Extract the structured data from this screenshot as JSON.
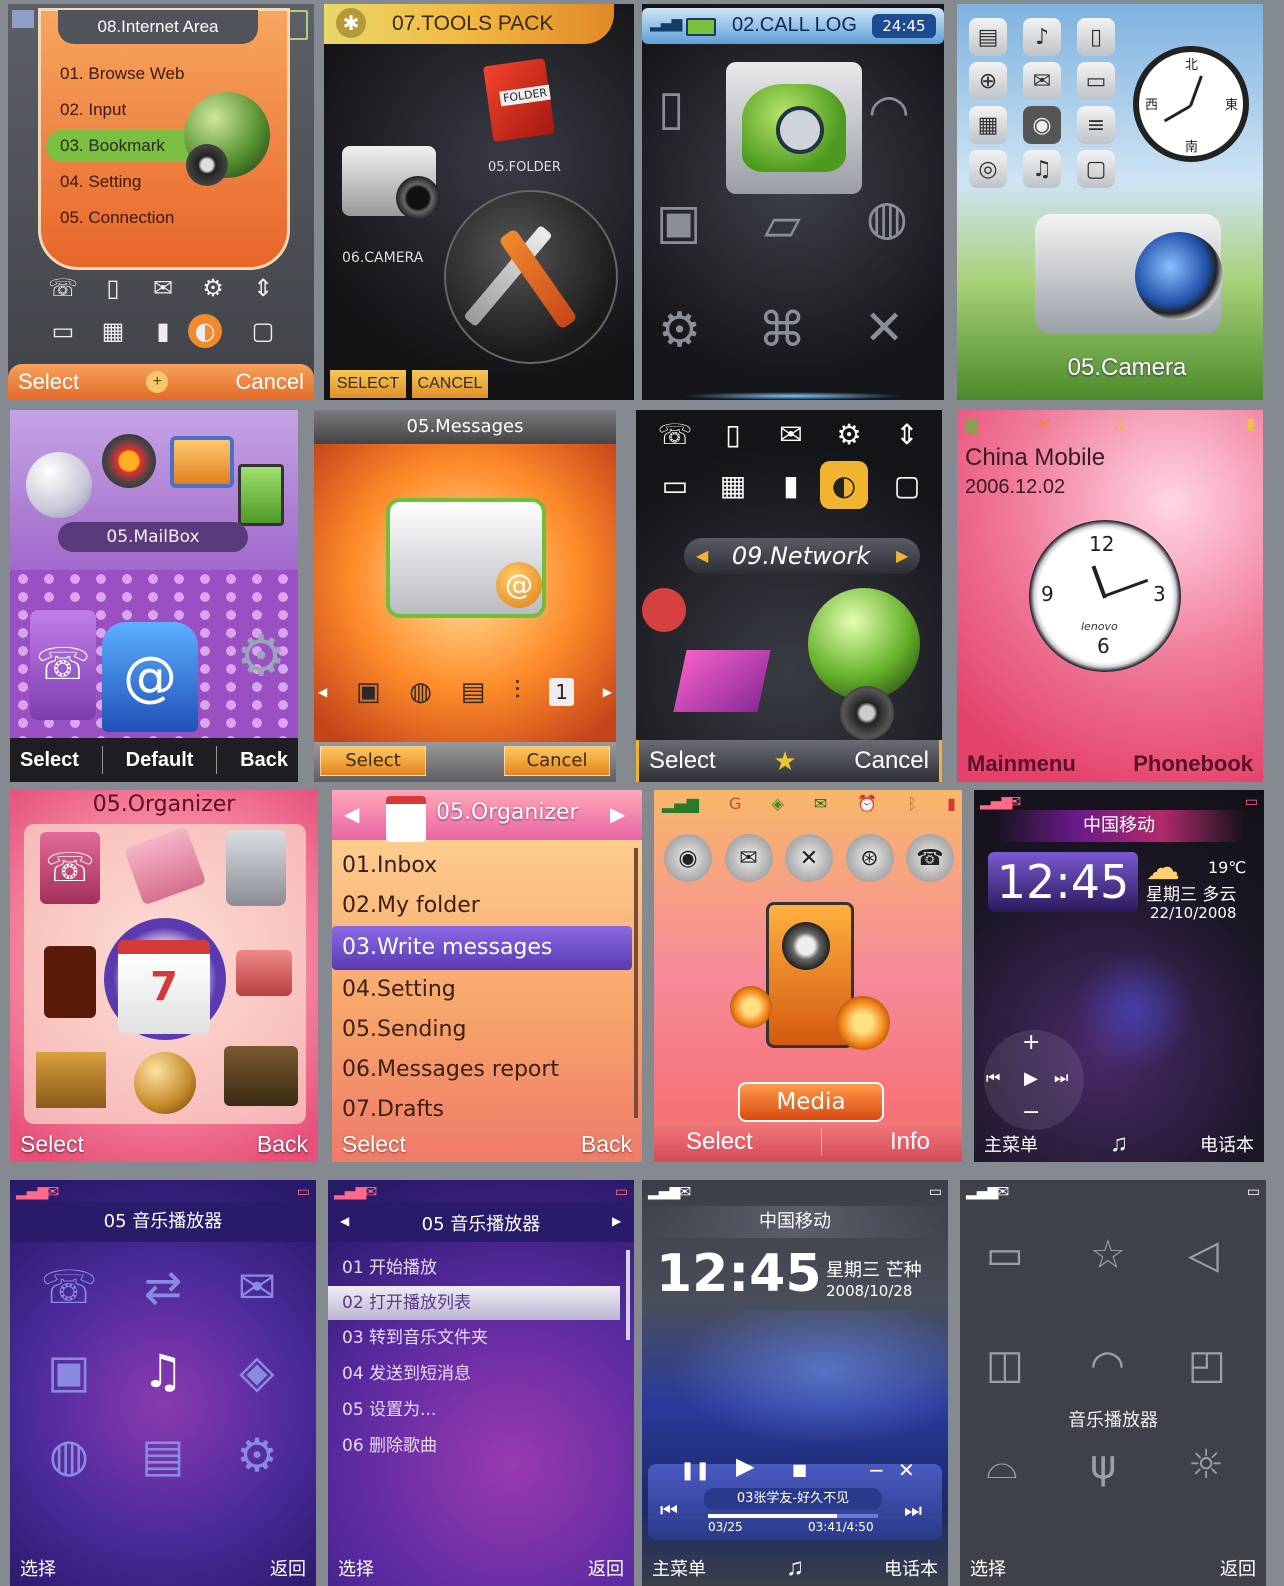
{
  "s1": {
    "title": "08.Internet Area",
    "items": [
      "01. Browse Web",
      "02. Input",
      "03. Bookmark",
      "04. Setting",
      "05. Connection"
    ],
    "left": "Select",
    "right": "Cancel"
  },
  "s2": {
    "title": "07.TOOLS PACK",
    "folder_tag": "FOLDER",
    "folder": "05.FOLDER",
    "camera": "06.CAMERA",
    "left": "SELECT",
    "right": "CANCEL"
  },
  "s3": {
    "title": "02.CALL LOG",
    "time": "24:45"
  },
  "s4": {
    "label": "05.Camera",
    "compass": {
      "n": "北",
      "s": "南",
      "e": "東",
      "w": "西"
    }
  },
  "s5": {
    "label": "05.MailBox",
    "left": "Select",
    "mid": "Default",
    "right": "Back"
  },
  "s6": {
    "title": "05.Messages",
    "left": "Select",
    "right": "Cancel",
    "cal": "1"
  },
  "s7": {
    "label": "09.Network",
    "left": "Select",
    "right": "Cancel"
  },
  "s8": {
    "operator": "China Mobile",
    "date": "2006.12.02",
    "brand": "lenovo",
    "n12": "12",
    "n3": "3",
    "n6": "6",
    "n9": "9",
    "left": "Mainmenu",
    "right": "Phonebook"
  },
  "s9": {
    "title": "05.Organizer",
    "left": "Select",
    "right": "Back",
    "cal": "7"
  },
  "s10": {
    "title": "05.Organizer",
    "items": [
      "01.Inbox",
      "02.My folder",
      "03.Write messages",
      "04.Setting",
      "05.Sending",
      "06.Messages report",
      "07.Drafts"
    ],
    "left": "Select",
    "right": "Back"
  },
  "s11": {
    "label": "Media",
    "left": "Select",
    "right": "Info"
  },
  "s12": {
    "operator": "中国移动",
    "time": "12:45",
    "temp": "19℃",
    "weekday": "星期三 多云",
    "date": "22/10/2008",
    "left": "主菜单",
    "right": "电话本"
  },
  "s13": {
    "title": "05 音乐播放器",
    "left": "选择",
    "right": "返回"
  },
  "s14": {
    "title": "05 音乐播放器",
    "items": [
      "01 开始播放",
      "02 打开播放列表",
      "03 转到音乐文件夹",
      "04 发送到短消息",
      "05 设置为...",
      "06 删除歌曲"
    ],
    "left": "选择",
    "right": "返回"
  },
  "s15": {
    "operator": "中国移动",
    "time": "12:45",
    "weekday": "星期三 芒种",
    "date": "2008/10/28",
    "song": "03张学友-好久不见",
    "track": "03/25",
    "elapsed": "03:41/4:50",
    "left": "主菜单",
    "right": "电话本",
    "progress": 0.76
  },
  "s16": {
    "label": "音乐播放器",
    "left": "选择",
    "right": "返回"
  },
  "colors": {
    "accent_orange": "#f08a2c",
    "accent_purple": "#6b3fb5",
    "green_highlight": "#6cc04a",
    "dark_panel": "#1c1f26"
  }
}
